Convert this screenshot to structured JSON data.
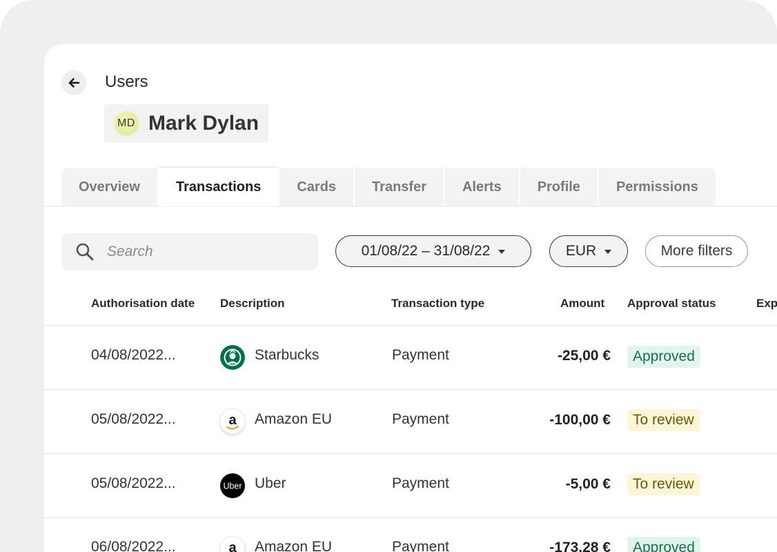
{
  "breadcrumb": {
    "label": "Users"
  },
  "user": {
    "initials": "MD",
    "name": "Mark Dylan"
  },
  "tabs": [
    {
      "label": "Overview",
      "active": false
    },
    {
      "label": "Transactions",
      "active": true
    },
    {
      "label": "Cards",
      "active": false
    },
    {
      "label": "Transfer",
      "active": false
    },
    {
      "label": "Alerts",
      "active": false
    },
    {
      "label": "Profile",
      "active": false
    },
    {
      "label": "Permissions",
      "active": false
    }
  ],
  "filters": {
    "search_placeholder": "Search",
    "date_range": "01/08/22 – 31/08/22",
    "currency": "EUR",
    "more_filters": "More filters"
  },
  "table": {
    "columns": [
      "Authorisation date",
      "Description",
      "Transaction type",
      "Amount",
      "Approval status",
      "Exp"
    ],
    "rows": [
      {
        "date": "04/08/2022...",
        "logo": "starbucks",
        "description": "Starbucks",
        "type": "Payment",
        "amount": "-25,00 €",
        "status": "Approved",
        "status_kind": "ok"
      },
      {
        "date": "05/08/2022...",
        "logo": "amazon",
        "description": "Amazon  EU",
        "type": "Payment",
        "amount": "-100,00 €",
        "status": "To review",
        "status_kind": "rev"
      },
      {
        "date": "05/08/2022...",
        "logo": "uber",
        "description": "Uber",
        "type": "Payment",
        "amount": "-5,00 €",
        "status": "To review",
        "status_kind": "rev"
      },
      {
        "date": "06/08/2022...",
        "logo": "amazon",
        "description": "Amazon EU",
        "type": "Payment",
        "amount": "-173,28 €",
        "status": "Approved",
        "status_kind": "ok"
      }
    ]
  },
  "logo_text": {
    "uber": "Uber",
    "amazon": "a"
  },
  "colors": {
    "approved_bg": "#e2f5ec",
    "approved_fg": "#16704a",
    "review_bg": "#fcf6d8",
    "review_fg": "#6b5708"
  },
  "icons": {
    "back": "arrow-left-icon",
    "search": "search-icon",
    "caret": "caret-down-icon"
  }
}
